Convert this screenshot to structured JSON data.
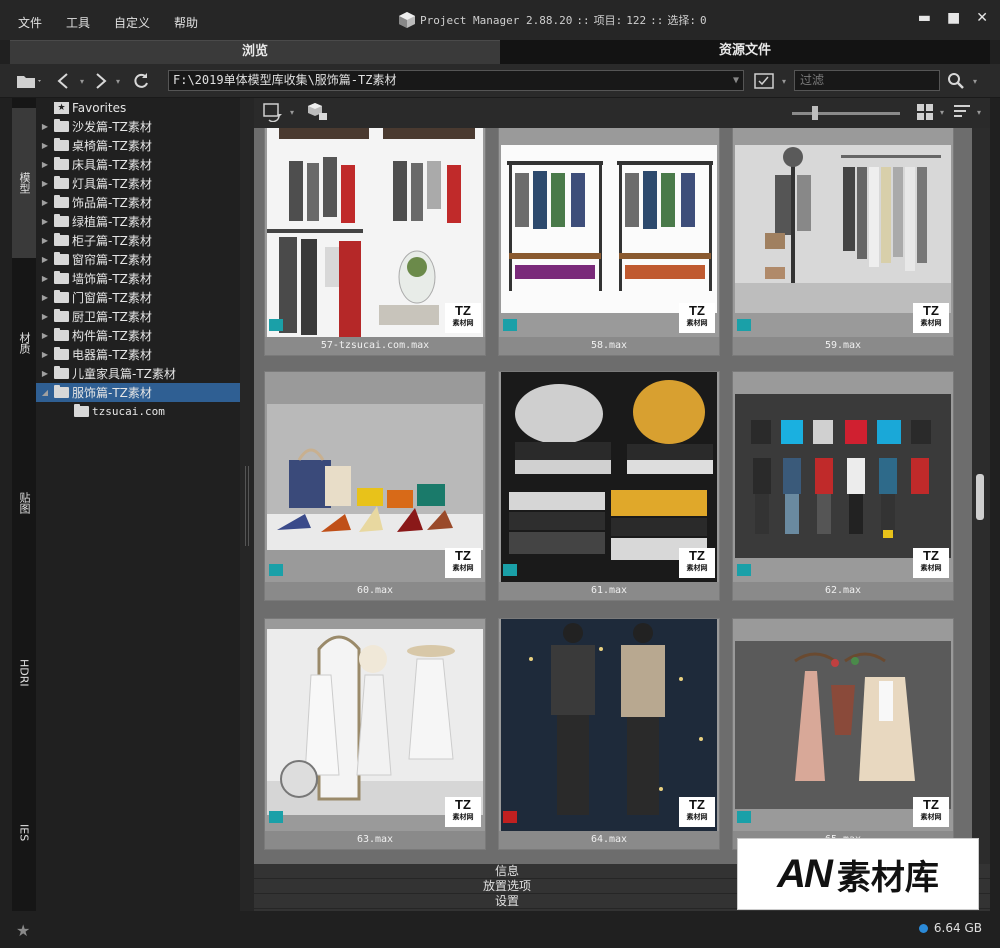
{
  "menu": [
    "文件",
    "工具",
    "自定义",
    "帮助"
  ],
  "title": {
    "app": "Project Manager 2.88.20",
    "sep1": "::",
    "items_label": "项目:",
    "items_count": "122",
    "sep2": "::",
    "selected_label": "选择:",
    "selected_count": "0"
  },
  "tabs": [
    "浏览",
    "资源文件"
  ],
  "toolbar": {
    "path": "F:\\2019单体模型库收集\\服饰篇-TZ素材",
    "filter_placeholder": "过滤"
  },
  "vertical_tabs": [
    "模型",
    "材质",
    "贴图",
    "HDRI",
    "IES"
  ],
  "tree": {
    "favorites": "Favorites",
    "items": [
      "沙发篇-TZ素材",
      "桌椅篇-TZ素材",
      "床具篇-TZ素材",
      "灯具篇-TZ素材",
      "饰品篇-TZ素材",
      "绿植篇-TZ素材",
      "柜子篇-TZ素材",
      "窗帘篇-TZ素材",
      "墙饰篇-TZ素材",
      "门窗篇-TZ素材",
      "厨卫篇-TZ素材",
      "构件篇-TZ素材",
      "电器篇-TZ素材",
      "儿童家具篇-TZ素材",
      "服饰篇-TZ素材"
    ],
    "selected": "服饰篇-TZ素材",
    "child": "tzsucai.com"
  },
  "cards": [
    {
      "label": "57-tzsucai.com.max"
    },
    {
      "label": "58.max"
    },
    {
      "label": "59.max"
    },
    {
      "label": "60.max"
    },
    {
      "label": "61.max"
    },
    {
      "label": "62.max"
    },
    {
      "label": "63.max"
    },
    {
      "label": "64.max"
    },
    {
      "label": "65.max"
    }
  ],
  "watermark": {
    "tz": "TZ",
    "tz_sub": "素材网"
  },
  "bottom_panels": [
    "信息",
    "放置选项",
    "设置"
  ],
  "status": {
    "disk": "6.64 GB"
  },
  "logo": {
    "an": "AN",
    "cn": "素材库"
  },
  "colors": {
    "selected": "#2f5f93",
    "badge": "#1aa0a8",
    "disk_dot": "#2b8ad8"
  }
}
